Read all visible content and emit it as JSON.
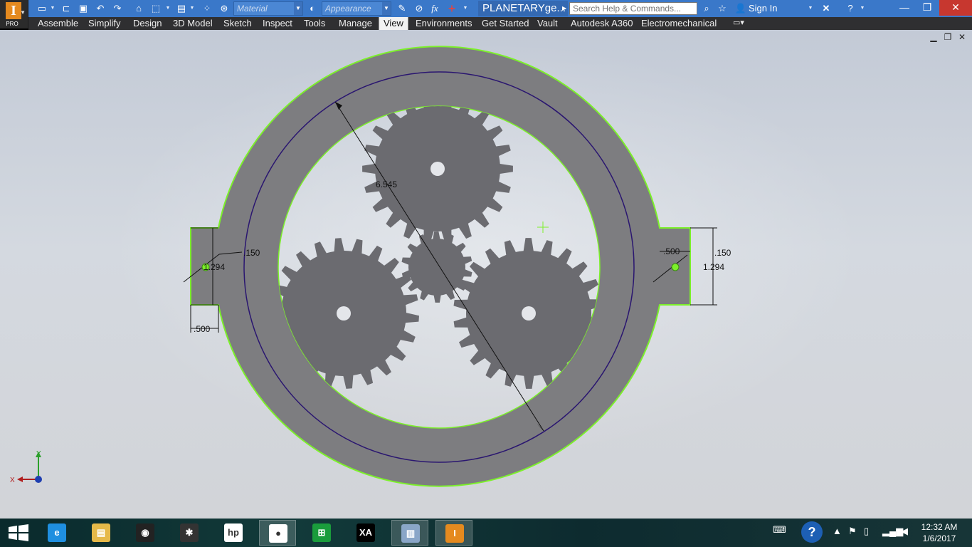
{
  "app": {
    "logo_letter": "I",
    "edition": "PRO",
    "document_title": "PLANETARYge...",
    "material_placeholder": "Material",
    "appearance_placeholder": "Appearance",
    "search_placeholder": "Search Help & Commands...",
    "sign_in": "Sign In",
    "fx_label": "fx"
  },
  "tabs": [
    {
      "label": "Assemble"
    },
    {
      "label": "Simplify"
    },
    {
      "label": "Design"
    },
    {
      "label": "3D Model"
    },
    {
      "label": "Sketch"
    },
    {
      "label": "Inspect"
    },
    {
      "label": "Tools"
    },
    {
      "label": "Manage"
    },
    {
      "label": "View",
      "active": true
    },
    {
      "label": "Environments"
    },
    {
      "label": "Get Started"
    },
    {
      "label": "Vault"
    },
    {
      "label": "Autodesk A360"
    },
    {
      "label": "Electromechanical"
    }
  ],
  "sketch": {
    "dimensions": {
      "diameter": "6.545",
      "left_height": "1.294",
      "left_offset": ".150",
      "left_width": ".500",
      "right_width": ".500",
      "right_offset": ".150",
      "right_height": "1.294"
    },
    "axis_x": "X",
    "axis_y": "Y",
    "colors": {
      "ring_fill": "#7d7d80",
      "gear_fill": "#6b6b70",
      "profile_edge": "#7cf02a",
      "construction_circle": "#2a1670",
      "dimension": "#111111"
    }
  },
  "taskbar": {
    "apps": [
      {
        "name": "internet-explorer",
        "glyph": "e",
        "color": "#1f8fe0"
      },
      {
        "name": "file-explorer",
        "glyph": "▤",
        "color": "#e6b949"
      },
      {
        "name": "webcam",
        "glyph": "◉",
        "color": "#222222"
      },
      {
        "name": "app-puzzle",
        "glyph": "✱",
        "color": "#333333"
      },
      {
        "name": "hp",
        "glyph": "hp",
        "color": "#ffffff"
      },
      {
        "name": "chrome",
        "glyph": "●",
        "color": "#ffffff"
      },
      {
        "name": "store",
        "glyph": "⊞",
        "color": "#1a9c3c"
      },
      {
        "name": "app-xa",
        "glyph": "XA",
        "color": "#000000"
      },
      {
        "name": "app-monitor",
        "glyph": "▥",
        "color": "#8aa6c8"
      },
      {
        "name": "inventor",
        "glyph": "I",
        "color": "#e58a1f"
      }
    ],
    "time": "12:32 AM",
    "date": "1/6/2017"
  }
}
